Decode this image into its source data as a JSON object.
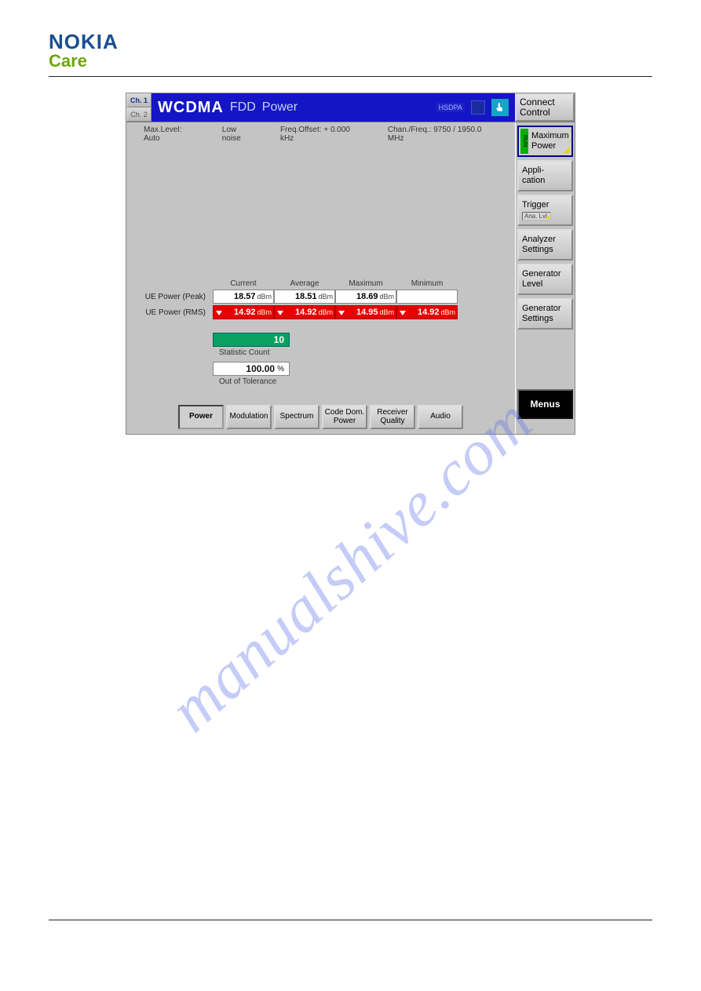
{
  "logo": {
    "brand": "NOKIA",
    "sub": "Care"
  },
  "watermark": "manualshive.com",
  "titlebar": {
    "ch1": "Ch. 1",
    "ch2": "Ch. 2",
    "main": "WCDMA",
    "fdd": "FDD",
    "power": "Power",
    "hsdpa": "HSDPA",
    "connect_l1": "Connect",
    "connect_l2": "Control"
  },
  "status": {
    "maxlevel": "Max.Level: Auto",
    "lownoise": "Low noise",
    "freqoffset": "Freq.Offset: + 0.000  kHz",
    "chanfreq": "Chan./Freq.: 9750 / 1950.0  MHz"
  },
  "columns": {
    "current": "Current",
    "average": "Average",
    "maximum": "Maximum",
    "minimum": "Minimum"
  },
  "rows": {
    "peak_label": "UE Power (Peak)",
    "rms_label": "UE Power (RMS)",
    "peak": {
      "current": {
        "val": "18.57",
        "unit": "dBm"
      },
      "average": {
        "val": "18.51",
        "unit": "dBm"
      },
      "maximum": {
        "val": "18.69",
        "unit": "dBm"
      },
      "minimum": {
        "val": "",
        "unit": ""
      }
    },
    "rms": {
      "current": {
        "val": "14.92",
        "unit": "dBm"
      },
      "average": {
        "val": "14.92",
        "unit": "dBm"
      },
      "maximum": {
        "val": "14.95",
        "unit": "dBm"
      },
      "minimum": {
        "val": "14.92",
        "unit": "dBm"
      }
    }
  },
  "stats": {
    "count_val": "10",
    "count_label": "Statistic Count",
    "oot_val": "100.00",
    "oot_unit": "%",
    "oot_label": "Out of Tolerance"
  },
  "tabs": {
    "power": "Power",
    "modulation": "Modulation",
    "spectrum": "Spectrum",
    "codedom_l1": "Code Dom.",
    "codedom_l2": "Power",
    "recvq_l1": "Receiver",
    "recvq_l2": "Quality",
    "audio": "Audio"
  },
  "side": {
    "run": "RUN",
    "maxpower_l1": "Maximum",
    "maxpower_l2": "Power",
    "app_l1": "Appli-",
    "app_l2": "cation",
    "trigger": "Trigger",
    "trigger_sub": "Ana. Lvl.",
    "analyzer_l1": "Analyzer",
    "analyzer_l2": "Settings",
    "gen_l1": "Generator",
    "gen_l2": "Level",
    "genset_l1": "Generator",
    "genset_l2": "Settings",
    "menus": "Menus"
  }
}
